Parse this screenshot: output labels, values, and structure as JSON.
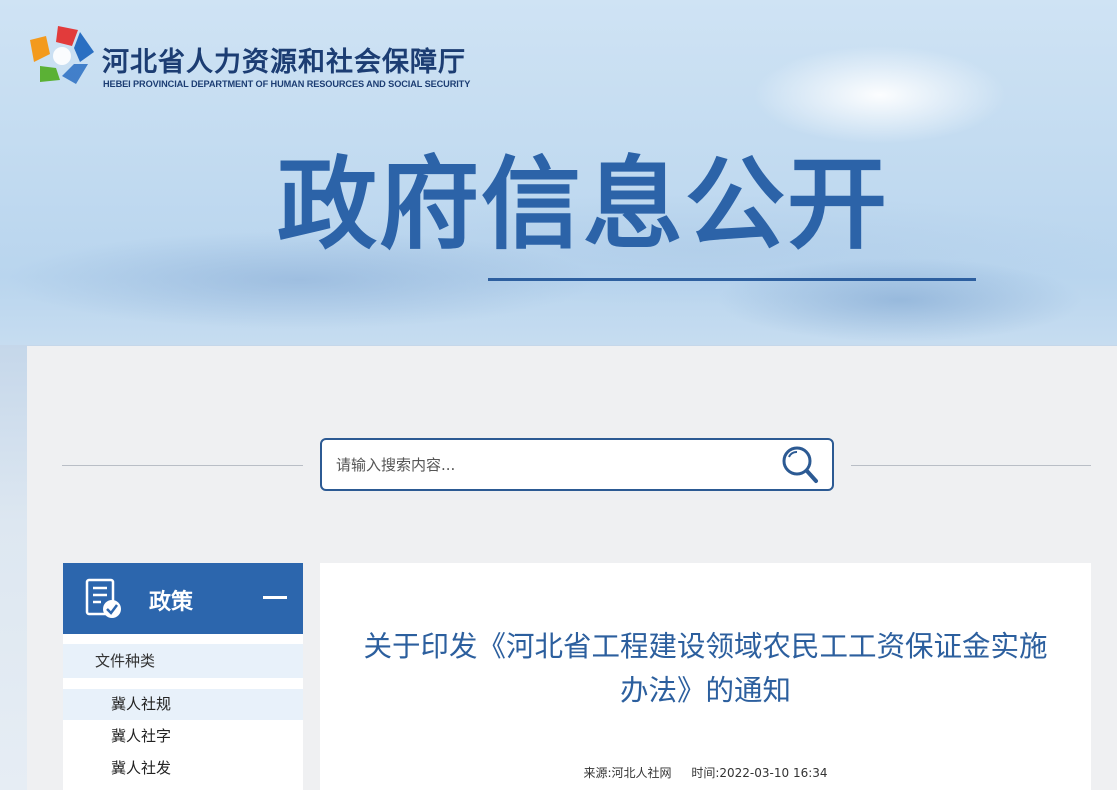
{
  "header": {
    "org_name_cn": "河北省人力资源和社会保障厅",
    "org_name_en": "HEBEI PROVINCIAL DEPARTMENT OF HUMAN RESOURCES AND SOCIAL SECURITY",
    "hero_title": "政府信息公开"
  },
  "search": {
    "placeholder": "请输入搜索内容...",
    "icon": "search-icon"
  },
  "sidebar": {
    "title": "政策",
    "icon": "document-check-icon",
    "collapse_icon": "minus-icon",
    "category_label": "文件种类",
    "items": [
      {
        "label": "冀人社规",
        "active": true
      },
      {
        "label": "冀人社字",
        "active": false
      },
      {
        "label": "冀人社发",
        "active": false
      }
    ]
  },
  "article": {
    "title_line1": "关于印发《河北省工程建设领域农民工工资保证金实施",
    "title_line2": "办法》的通知",
    "source": "来源:河北人社网",
    "time": "时间:2022-03-10 16:34"
  },
  "colors": {
    "brand_blue": "#2c66ad",
    "title_blue": "#2c5f9e",
    "logo_red": "#e23b3b",
    "logo_orange": "#f39a1d",
    "logo_green": "#5bb135",
    "logo_blue": "#2a6fc2"
  }
}
